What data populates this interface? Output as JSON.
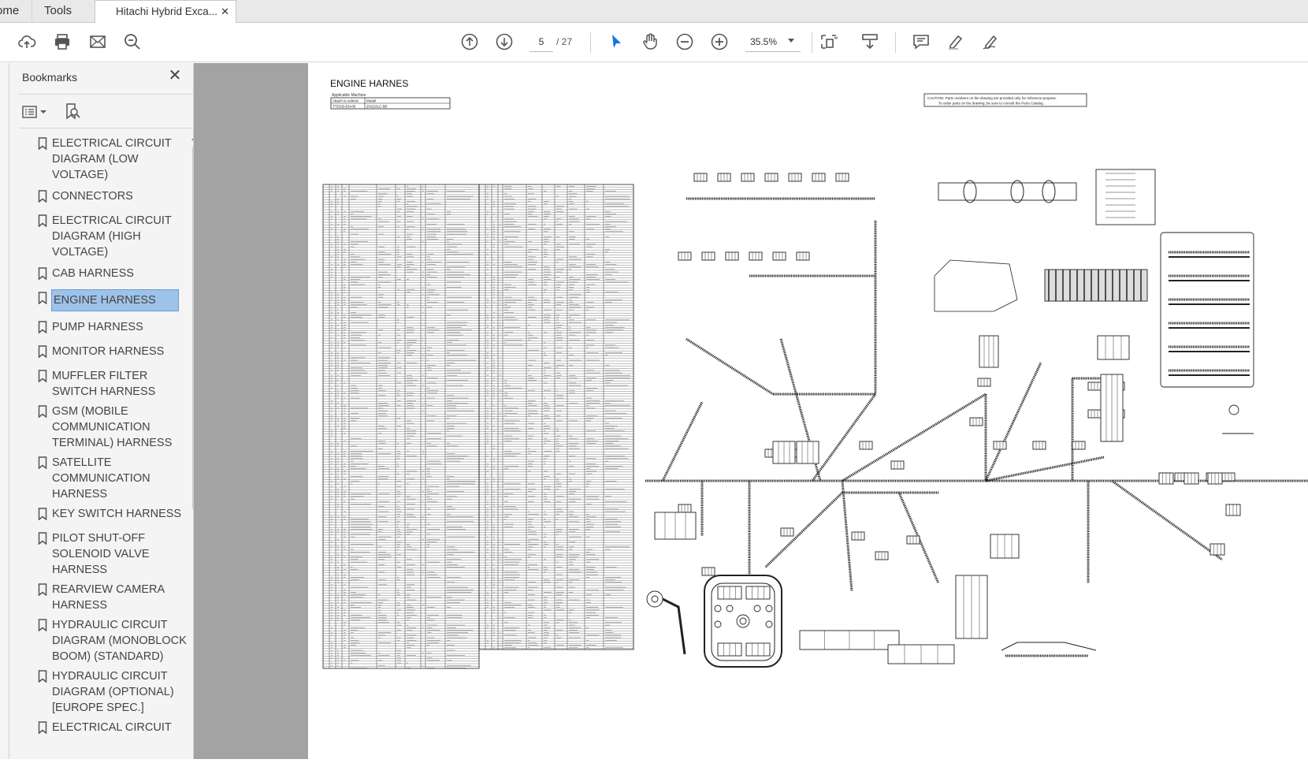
{
  "tabs": {
    "home": "ome",
    "tools": "Tools",
    "document": "Hitachi Hybrid Exca..."
  },
  "toolbar": {
    "page_current": "5",
    "page_total": "/ 27",
    "zoom": "35.5%"
  },
  "icons": {
    "upload": "upload-cloud-icon",
    "print": "print-icon",
    "email": "email-icon",
    "search": "search-icon",
    "prev": "page-up-icon",
    "next": "page-down-icon",
    "select": "select-cursor-icon",
    "hand": "hand-icon",
    "zoom_out": "zoom-out-icon",
    "zoom_in": "zoom-in-icon"
  },
  "bookmarks": {
    "title": "Bookmarks",
    "items": [
      "ELECTRICAL CIRCUIT DIAGRAM (LOW VOLTAGE)",
      "CONNECTORS",
      "ELECTRICAL CIRCUIT DIAGRAM (HIGH VOLTAGE)",
      "CAB HARNESS",
      "ENGINE HARNESS",
      "PUMP HARNESS",
      "MONITOR HARNESS",
      "MUFFLER FILTER SWITCH HARNESS",
      "GSM (MOBILE COMMUNICATION TERMINAL) HARNESS",
      "SATELLITE COMMUNICATION HARNESS",
      "KEY SWITCH HARNESS",
      "PILOT SHUT-OFF SOLENOID VALVE HARNESS",
      "REARVIEW CAMERA HARNESS",
      "HYDRAULIC CIRCUIT DIAGRAM (MONOBLOCK BOOM) (STANDARD)",
      "HYDRAULIC CIRCUIT DIAGRAM (OPTIONAL) [EUROPE SPEC.]",
      "ELECTRICAL CIRCUIT"
    ],
    "selected_index": 4
  },
  "document": {
    "title": "ENGINE HARNES",
    "applicable_label": "Applicable Machine",
    "attach_label": "Attach to vehicle",
    "model_label": "Model",
    "part_no": "TTDCB-EN-00",
    "model": "ZH210LC-5B",
    "caution": "CAUTION: Parts numbers on the drawing are provided only for reference purpose.",
    "caution2": "To order parts on the drawing, be sure to consult the Parts Catalog."
  },
  "colors": {
    "selected_bg": "#9ec3ea",
    "select_tool": "#1473e6",
    "viewport_bg": "#a3a3a3"
  }
}
